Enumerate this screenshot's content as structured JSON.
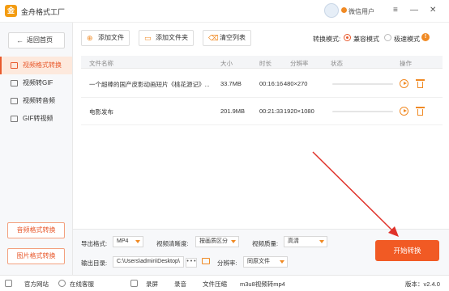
{
  "app": {
    "title": "金舟格式工厂",
    "user": "微信用户",
    "logo_char": "金"
  },
  "window_controls": {
    "menu": "≡",
    "minimize": "—",
    "close": "✕"
  },
  "sidebar": {
    "back_label": "返回首页",
    "items": [
      {
        "label": "视频格式转换",
        "active": true
      },
      {
        "label": "视频转GIF",
        "active": false
      },
      {
        "label": "视频转音频",
        "active": false
      },
      {
        "label": "GIF转视频",
        "active": false
      }
    ],
    "bottom_buttons": [
      "音频格式转换",
      "图片格式转换"
    ]
  },
  "toolbar": {
    "add_file": "添加文件",
    "add_folder": "添加文件夹",
    "clear_list": "清空列表",
    "mode_label": "转换模式:",
    "mode_compat": "兼容模式",
    "mode_fast": "极速模式",
    "selected_mode": "兼容模式"
  },
  "table": {
    "headers": [
      "文件名称",
      "大小",
      "时长",
      "分辨率",
      "状态",
      "操作"
    ],
    "rows": [
      {
        "name": "一个超棒的国产皮影动画短片《桃花源记》...",
        "size": "33.7MB",
        "duration": "00:16:16",
        "resolution": "480×270",
        "progress": 0
      },
      {
        "name": "电影发布",
        "size": "201.9MB",
        "duration": "00:21:33",
        "resolution": "1920×1080",
        "progress": 0
      }
    ]
  },
  "settings": {
    "export_format_label": "导出格式:",
    "export_format": "MP4",
    "clarity_label": "视频清晰度:",
    "clarity": "按画质区分",
    "quality_label": "视频质量:",
    "quality": "高清",
    "output_dir_label": "输出目录:",
    "output_dir": "C:\\Users\\admin\\Desktop\\",
    "dots": "• • •",
    "resolution_label": "分辨率:",
    "resolution": "同原文件",
    "start_button": "开始转换"
  },
  "statusbar": {
    "website": "官方网站",
    "support": "在线客服",
    "record": "录屏",
    "audio_record": "录音",
    "file_compress": "文件压缩",
    "m3u8": "m3u8视频转mp4",
    "version": "版本：v2.4.0"
  },
  "colors": {
    "accent": "#f15a24",
    "accent_light": "#fde9dd",
    "annotation_arrow": "#e0322a"
  }
}
